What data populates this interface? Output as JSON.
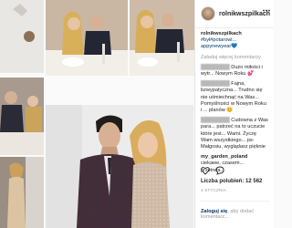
{
  "profile": {
    "username": "rolnikwszpilkach"
  },
  "caption": {
    "user": "rolnikwszpilkach",
    "text": "#był#potarowi...",
    "hashtag": "appynewyear💙"
  },
  "load_more": "Załaduj więcej komentarzy",
  "comments": [
    {
      "user": "",
      "text": "Dużo miłości i wytr... Nowym Roku 💕"
    },
    {
      "user": "",
      "text": "Fajna, bzwypatyczna... Trudno się nie uśmiechnąć na Was... Pomyślności w Nowym Roku i ... planów 😊"
    },
    {
      "user": "",
      "text": "Cudowna z Was para... patrzeć na to uczucie które jest... Wami. Życzę Wam wszystkiego... ps-Małgosiu, wyglądasz pięknie"
    },
    {
      "user": "my_garden_poland",
      "text": "ciekawe, czasem... przetrwa..."
    }
  ],
  "likes": {
    "label": "Liczba polubień:",
    "count": "12 562"
  },
  "date": "4 STYCZNIA",
  "login_prompt": {
    "link": "Zaloguj się",
    "rest": ", aby dodać komentarz..."
  },
  "colors": {
    "accent": "#003569",
    "text": "#262626",
    "muted": "#999999"
  }
}
